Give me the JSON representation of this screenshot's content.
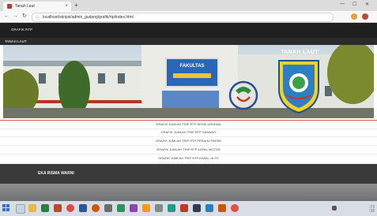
{
  "browser": {
    "tab_title": "Tanah Laut",
    "tab_close": "×",
    "new_tab": "+",
    "url": "localhost/skripsi/admin_gudang/grafik/rtp/index.html",
    "min": "—",
    "max": "☐",
    "close": "✕"
  },
  "nav": {
    "top_link": "GRAFIK RTP",
    "sub_link": "TANAH LAUT"
  },
  "banner": {
    "sign_line1": "FAKULTAS",
    "crest_title": "TANAH LAUT"
  },
  "menu": {
    "items": [
      "GRAFIK JUMLAH TRIP RTP KESELURUHAN",
      "GRAFIK JUMLAH TRIP RTP SAWANG",
      "GRAFIK JUMLAH TRIP RTP PERAHU PAPAN",
      "GRAFIK JUMLAH TRIP RTP KAPAL MOTOR",
      "GRAFIK JUMLAH TRIP RTP KAPAL >5 GT"
    ]
  },
  "footer": {
    "name": "EKA RISMA WARNI"
  },
  "colors": {
    "nav_bg": "#1f1f1f",
    "footer_bg": "#3a3a3a",
    "accent": "#d9534f"
  }
}
